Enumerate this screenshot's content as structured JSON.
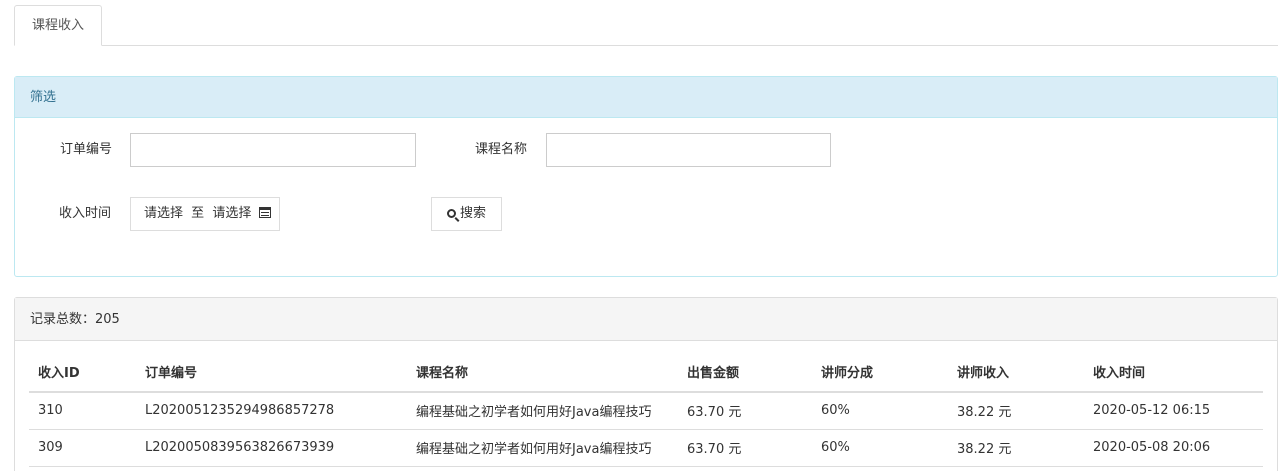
{
  "tabs": [
    {
      "label": "课程收入"
    }
  ],
  "filter": {
    "header": "筛选",
    "order_no_label": "订单编号",
    "order_no_value": "",
    "course_name_label": "课程名称",
    "course_name_value": "",
    "income_time_label": "收入时间",
    "date_start": "请选择",
    "date_sep": "至",
    "date_end": "请选择",
    "calendar_icon": "calendar-icon",
    "search_icon": "search-icon",
    "search_label": "搜索"
  },
  "list": {
    "total_label": "记录总数：",
    "total_count": "205",
    "columns": [
      "收入ID",
      "订单编号",
      "课程名称",
      "出售金额",
      "讲师分成",
      "讲师收入",
      "收入时间"
    ],
    "rows": [
      [
        "310",
        "L202005123529498685​7278",
        "编程基础之初学者如何用好Java编程技巧",
        "63.70 元",
        "60%",
        "38.22 元",
        "2020-05-12 06:15"
      ],
      [
        "309",
        "L2020050839563826673939",
        "编程基础之初学者如何用好Java编程技巧",
        "63.70 元",
        "60%",
        "38.22 元",
        "2020-05-08 20:06"
      ]
    ]
  }
}
